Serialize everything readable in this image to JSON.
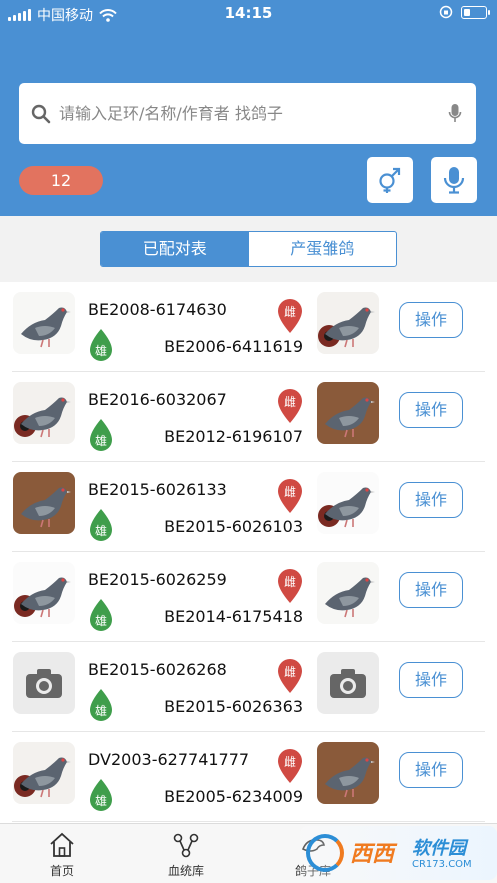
{
  "status_bar": {
    "carrier": "中国移动",
    "time": "14:15"
  },
  "search": {
    "placeholder": "请输入足环/名称/作育者 找鸽子"
  },
  "count_badge": "12",
  "segments": {
    "active": "已配对表",
    "inactive": "产蛋雏鸽"
  },
  "sex_labels": {
    "male": "雄",
    "female": "雌"
  },
  "pairs": [
    {
      "male_ring": "BE2008-6174630",
      "female_ring": "BE2006-6411619",
      "action": "操作",
      "left_photo": "pigeon-photo",
      "right_photo": "pigeon-photo"
    },
    {
      "male_ring": "BE2016-6032067",
      "female_ring": "BE2012-6196107",
      "action": "操作",
      "left_photo": "pigeon-photo",
      "right_photo": "pigeon-photo"
    },
    {
      "male_ring": "BE2015-6026133",
      "female_ring": "BE2015-6026103",
      "action": "操作",
      "left_photo": "pigeon-photo",
      "right_photo": "pigeon-photo"
    },
    {
      "male_ring": "BE2015-6026259",
      "female_ring": "BE2014-6175418",
      "action": "操作",
      "left_photo": "pigeon-photo",
      "right_photo": "pigeon-photo"
    },
    {
      "male_ring": "BE2015-6026268",
      "female_ring": "BE2015-6026363",
      "action": "操作",
      "left_photo": "camera-icon",
      "right_photo": "camera-icon"
    },
    {
      "male_ring": "DV2003-627741777",
      "female_ring": "BE2005-6234009",
      "action": "操作",
      "left_photo": "pigeon-photo",
      "right_photo": "pigeon-photo"
    }
  ],
  "tabs": [
    {
      "label": "首页",
      "icon": "home-icon"
    },
    {
      "label": "血统库",
      "icon": "pedigree-icon"
    },
    {
      "label": "鸽子库",
      "icon": "pigeon-icon"
    }
  ],
  "watermark": {
    "brand": "西西",
    "site": "软件园",
    "url": "CR173.COM"
  },
  "colors": {
    "header": "#4a90d3",
    "badge": "#e2735f",
    "male": "#3f9e4b",
    "female": "#d04a43",
    "accent": "#4a90d3"
  }
}
